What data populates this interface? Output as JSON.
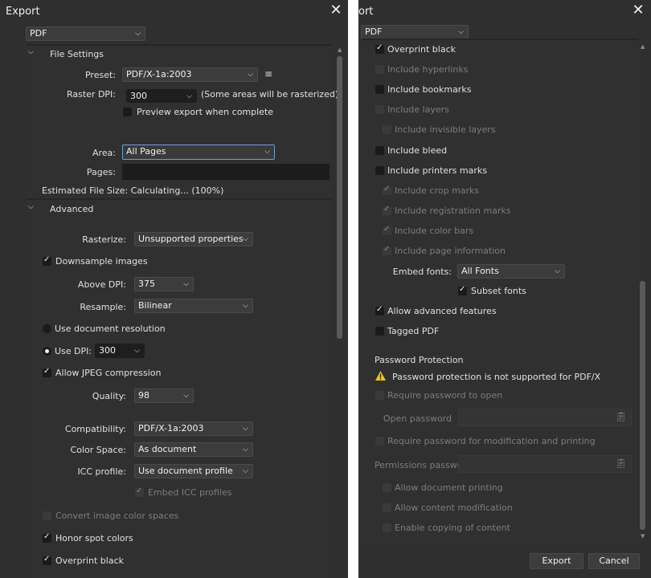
{
  "left": {
    "title": "Export",
    "format": "PDF",
    "file_settings": {
      "header": "File Settings",
      "preset_label": "Preset:",
      "preset_value": "PDF/X-1a:2003",
      "raster_dpi_label": "Raster DPI:",
      "raster_dpi_value": "300",
      "raster_note": "(Some areas will be rasterized)",
      "preview_label": "Preview export when complete",
      "area_label": "Area:",
      "area_value": "All Pages",
      "pages_label": "Pages:",
      "pages_value": "",
      "estimated_size": "Estimated File Size: Calculating... (100%)"
    },
    "advanced": {
      "header": "Advanced",
      "rasterize_label": "Rasterize:",
      "rasterize_value": "Unsupported properties",
      "downsample_label": "Downsample images",
      "above_dpi_label": "Above DPI:",
      "above_dpi_value": "375",
      "resample_label": "Resample:",
      "resample_value": "Bilinear",
      "use_doc_res_label": "Use document resolution",
      "use_dpi_label": "Use DPI:",
      "use_dpi_value": "300",
      "jpeg_label": "Allow JPEG compression",
      "quality_label": "Quality:",
      "quality_value": "98",
      "compat_label": "Compatibility:",
      "compat_value": "PDF/X-1a:2003",
      "color_space_label": "Color Space:",
      "color_space_value": "As document",
      "icc_label": "ICC profile:",
      "icc_value": "Use document profile",
      "embed_icc_label": "Embed ICC profiles",
      "convert_label": "Convert image color spaces",
      "honor_spot_label": "Honor spot colors",
      "overprint_label": "Overprint black"
    }
  },
  "right": {
    "title": "ort",
    "format": "PDF",
    "options": {
      "overprint_black": "Overprint black",
      "include_hyperlinks": "Include hyperlinks",
      "include_bookmarks": "Include bookmarks",
      "include_layers": "Include layers",
      "include_invisible_layers": "Include invisible layers",
      "include_bleed": "Include bleed",
      "include_printers_marks": "Include printers marks",
      "include_crop_marks": "Include crop marks",
      "include_registration_marks": "Include registration marks",
      "include_color_bars": "Include color bars",
      "include_page_information": "Include page information",
      "embed_fonts_label": "Embed fonts:",
      "embed_fonts_value": "All Fonts",
      "subset_fonts": "Subset fonts",
      "allow_advanced": "Allow advanced features",
      "tagged_pdf": "Tagged PDF"
    },
    "password": {
      "header": "Password Protection",
      "warning": "Password protection is not supported for PDF/X",
      "require_open": "Require password to open",
      "open_password_label": "Open password",
      "require_mod": "Require password for modification and printing",
      "permissions_label": "Permissions password",
      "allow_printing": "Allow document printing",
      "allow_modification": "Allow content modification",
      "enable_copying": "Enable copying of content"
    },
    "buttons": {
      "export": "Export",
      "cancel": "Cancel"
    }
  }
}
